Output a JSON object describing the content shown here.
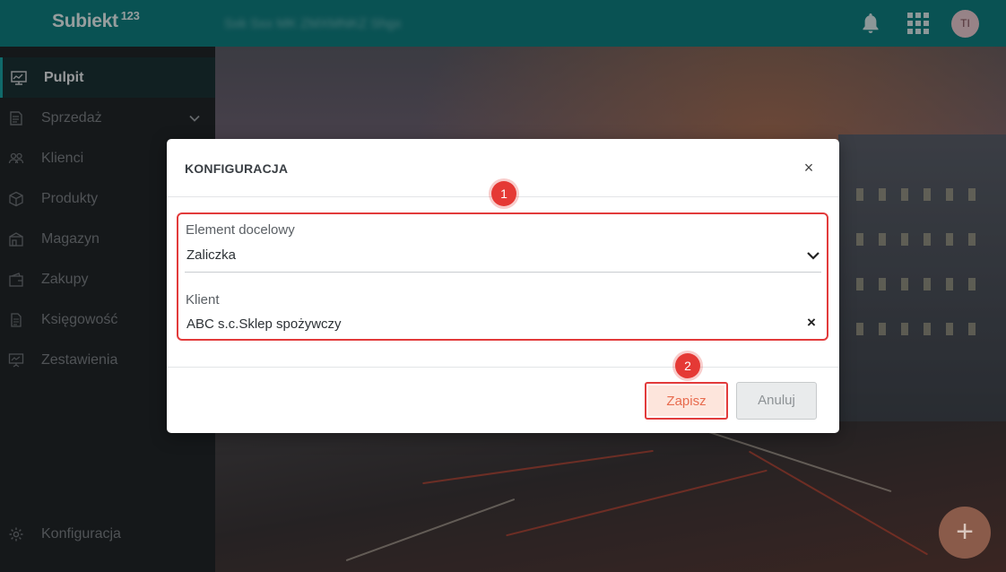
{
  "app": {
    "logo": "Subiekt",
    "logo_sup": "123",
    "company_name": "Sxk Sxx MK ZMXMNKZ Shgx",
    "user_initials": "TI"
  },
  "sidebar": {
    "items": [
      {
        "label": "Pulpit",
        "icon": "monitor-icon",
        "active": true
      },
      {
        "label": "Sprzedaż",
        "icon": "receipt-icon",
        "expandable": true
      },
      {
        "label": "Klienci",
        "icon": "users-icon"
      },
      {
        "label": "Produkty",
        "icon": "box-icon"
      },
      {
        "label": "Magazyn",
        "icon": "warehouse-icon"
      },
      {
        "label": "Zakupy",
        "icon": "wallet-icon"
      },
      {
        "label": "Księgowość",
        "icon": "document-icon"
      },
      {
        "label": "Zestawienia",
        "icon": "presentation-icon"
      }
    ],
    "footer_item": {
      "label": "Konfiguracja",
      "icon": "gear-icon"
    }
  },
  "modal": {
    "title": "KONFIGURACJA",
    "fields": [
      {
        "label": "Element docelowy",
        "value": "Zaliczka"
      },
      {
        "label": "Klient",
        "value": "ABC s.c.Sklep spożywczy"
      }
    ],
    "save_label": "Zapisz",
    "cancel_label": "Anuluj"
  },
  "annotations": {
    "badge1": "1",
    "badge2": "2"
  },
  "colors": {
    "topbar": "#0f7e80",
    "sidebar": "#212529",
    "highlight": "#e23b3b",
    "save_text": "#e86b4e"
  }
}
